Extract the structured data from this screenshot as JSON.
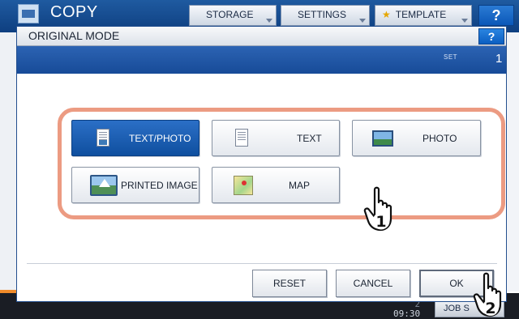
{
  "background_app": {
    "title": "COPY",
    "tabs": [
      "STORAGE",
      "SETTINGS",
      "TEMPLATE"
    ],
    "help": "?",
    "clock": {
      "date": "2",
      "time": "09:30"
    },
    "job_button": "JOB S"
  },
  "dialog": {
    "title": "ORIGINAL MODE",
    "help": "?",
    "set_label": "SET",
    "set_count": "1"
  },
  "modes": [
    {
      "label": "TEXT/PHOTO",
      "icon": "text-photo-icon",
      "selected": true
    },
    {
      "label": "TEXT",
      "icon": "text-document-icon",
      "selected": false
    },
    {
      "label": "PHOTO",
      "icon": "photo-icon",
      "selected": false
    },
    {
      "label": "PRINTED IMAGE",
      "icon": "printed-image-icon",
      "selected": false
    },
    {
      "label": "MAP",
      "icon": "map-icon",
      "selected": false
    }
  ],
  "actions": {
    "reset": "RESET",
    "cancel": "CANCEL",
    "ok": "OK"
  },
  "callouts": [
    "1",
    "2"
  ],
  "colors": {
    "header_blue": "#174b98",
    "selected_blue": "#0f4f9f",
    "highlight_frame": "#ec9b82"
  }
}
